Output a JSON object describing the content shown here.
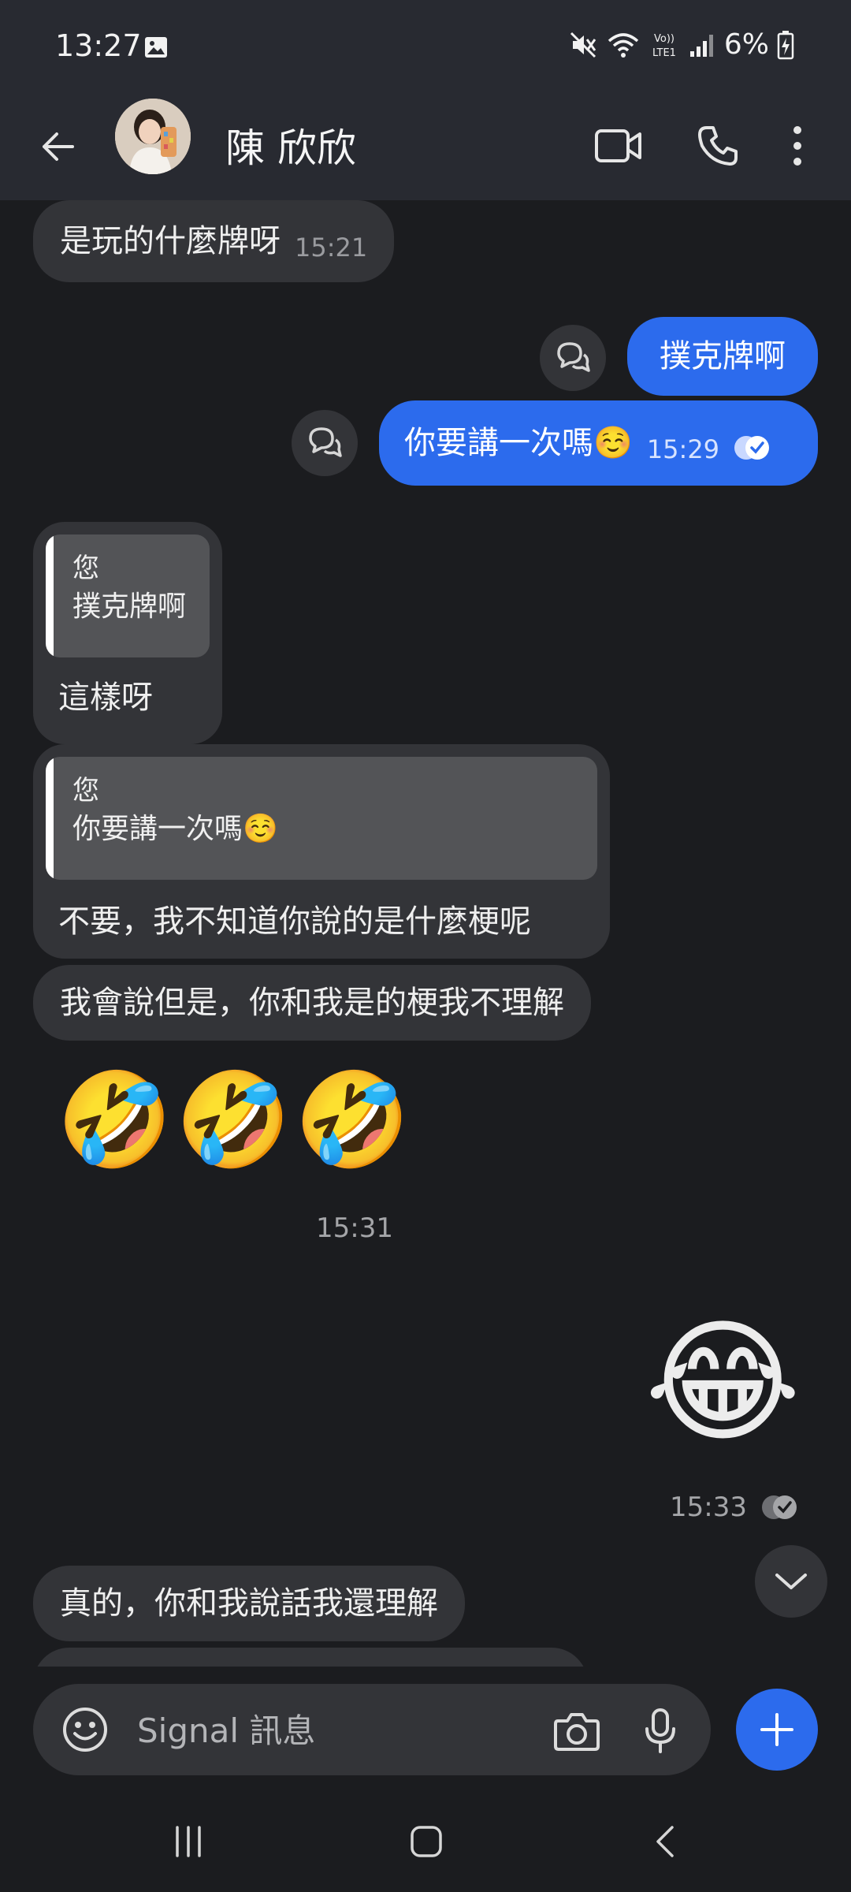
{
  "status_bar": {
    "time": "13:27",
    "battery": "6%",
    "network": "LTE1"
  },
  "header": {
    "contact_name": "陳 欣欣"
  },
  "messages": {
    "m1": {
      "text": "是玩的什麼牌呀",
      "time": "15:21"
    },
    "m2": {
      "text": "撲克牌啊"
    },
    "m3": {
      "text": "你要講一次嗎",
      "emoji": "☺️",
      "time": "15:29"
    },
    "m4": {
      "quote_author": "您",
      "quote_text": "撲克牌啊",
      "text": "這樣呀"
    },
    "m5": {
      "quote_author": "您",
      "quote_text": "你要講一次嗎",
      "quote_emoji": "☺️",
      "text": "不要，我不知道你說的是什麼梗呢"
    },
    "m6": {
      "text": "我會說但是，你和我是的梗我不理解"
    },
    "m7": {
      "emoji": "🤣🤣🤣",
      "time": "15:31"
    },
    "m8": {
      "emoji": "😂",
      "time": "15:33"
    },
    "m9": {
      "text": "真的，你和我說話我還理解"
    }
  },
  "compose": {
    "placeholder": "Signal 訊息"
  },
  "colors": {
    "accent": "#2c6bed",
    "background": "#1b1c1f",
    "bubble_incoming": "#333438",
    "header": "#282a31"
  },
  "icons": [
    "back-arrow-icon",
    "video-call-icon",
    "phone-icon",
    "more-options-icon",
    "reaction-icon",
    "delivered-check-icon",
    "chevron-down-icon",
    "emoji-icon",
    "camera-icon",
    "microphone-icon",
    "plus-icon"
  ]
}
